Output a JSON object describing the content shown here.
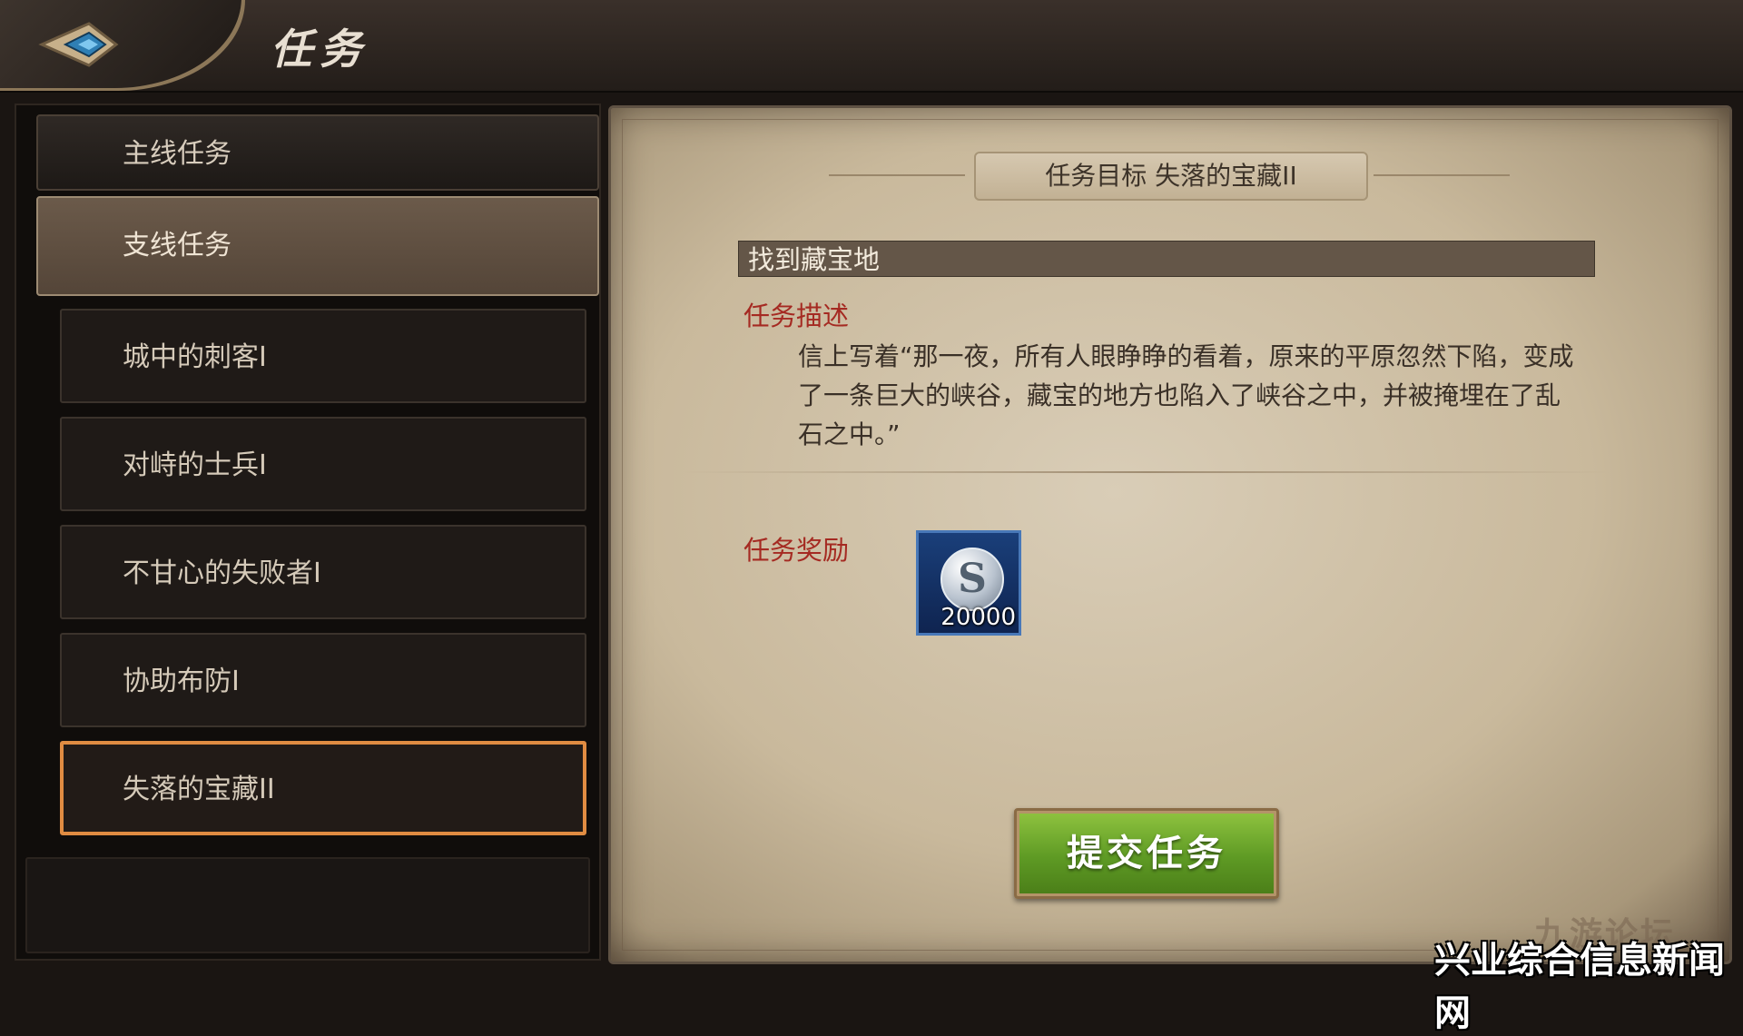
{
  "header": {
    "title": "任务"
  },
  "sidebar": {
    "categories": [
      {
        "label": "主线任务",
        "active": false
      },
      {
        "label": "支线任务",
        "active": true
      }
    ],
    "quests": [
      {
        "label": "城中的刺客I"
      },
      {
        "label": "对峙的士兵I"
      },
      {
        "label": "不甘心的失败者I"
      },
      {
        "label": "协助布防I"
      },
      {
        "label": "失落的宝藏II",
        "selected": true
      }
    ]
  },
  "detail": {
    "target_header": "任务目标  失落的宝藏II",
    "objective": "找到藏宝地",
    "description_label": "任务描述",
    "description": "信上写着“那一夜，所有人眼睁睁的看着，原来的平原忽然下陷，变成了一条巨大的峡谷，藏宝的地方也陷入了峡谷之中，并被掩埋在了乱石之中。”",
    "reward_label": "任务奖励",
    "reward": {
      "icon": "silver-coin-icon",
      "symbol": "S",
      "amount": "20000"
    },
    "submit_label": "提交任务"
  },
  "watermark": {
    "logo": "九游论坛",
    "text": "兴业综合信息新闻网"
  },
  "colors": {
    "accent_red": "#a52a22",
    "button_green": "#6aa62c",
    "selected_border": "#e08c42"
  }
}
